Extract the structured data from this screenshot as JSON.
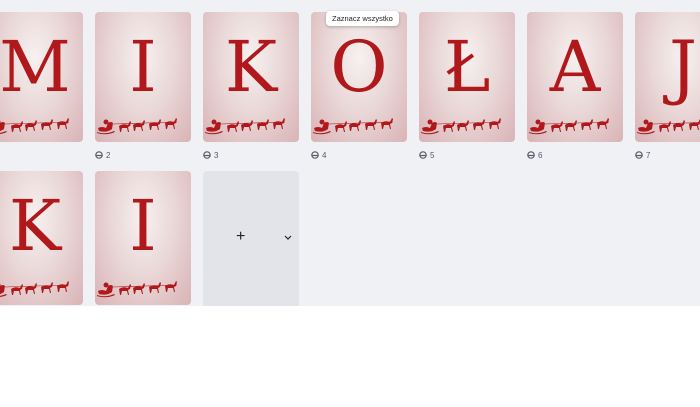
{
  "tooltip": {
    "select_all": "Zaznacz wszystko"
  },
  "pages": [
    {
      "letter": "M",
      "number": ""
    },
    {
      "letter": "I",
      "number": "2"
    },
    {
      "letter": "K",
      "number": "3"
    },
    {
      "letter": "O",
      "number": "4"
    },
    {
      "letter": "Ł",
      "number": "5"
    },
    {
      "letter": "A",
      "number": "6"
    },
    {
      "letter": "J",
      "number": "7"
    },
    {
      "letter": "K",
      "number": ""
    },
    {
      "letter": "I",
      "number": ""
    }
  ],
  "add_page": {
    "icon": "plus-icon",
    "menu_icon": "chevron-down-icon"
  },
  "colors": {
    "letter": "#b0181c",
    "background": "#f0f1f5",
    "tile": "#e3e4e9"
  }
}
